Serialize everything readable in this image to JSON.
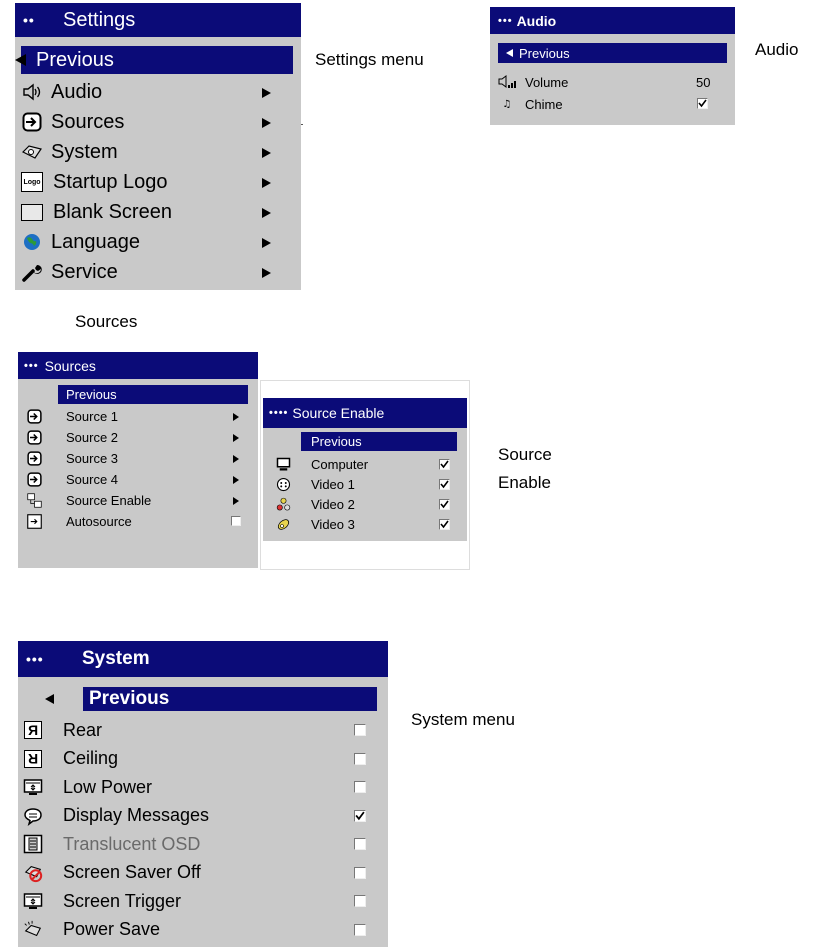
{
  "settings": {
    "header": "Settings",
    "previous": "Previous",
    "items": [
      {
        "icon": "speaker-icon",
        "label": "Audio"
      },
      {
        "icon": "source-input-icon",
        "label": "Sources"
      },
      {
        "icon": "system-icon",
        "label": "System"
      },
      {
        "icon": "logo-icon",
        "label": "Startup Logo",
        "icon_text": "Logo"
      },
      {
        "icon": "blank-screen-icon",
        "label": "Blank Screen"
      },
      {
        "icon": "globe-icon",
        "label": "Language"
      },
      {
        "icon": "wrench-icon",
        "label": "Service"
      }
    ]
  },
  "audio": {
    "header": "Audio",
    "previous": "Previous",
    "items": [
      {
        "icon": "volume-icon",
        "label": "Volume",
        "value": "50"
      },
      {
        "icon": "chime-icon",
        "label": "Chime",
        "checked": true
      }
    ]
  },
  "sources": {
    "header": "Sources",
    "previous": "Previous",
    "items": [
      {
        "icon": "source-input-icon",
        "label": "Source 1",
        "type": "submenu"
      },
      {
        "icon": "source-input-icon",
        "label": "Source 2",
        "type": "submenu"
      },
      {
        "icon": "source-input-icon",
        "label": "Source 3",
        "type": "submenu"
      },
      {
        "icon": "source-input-icon",
        "label": "Source 4",
        "type": "submenu"
      },
      {
        "icon": "source-enable-icon",
        "label": "Source Enable",
        "type": "submenu"
      },
      {
        "icon": "autosource-icon",
        "label": "Autosource",
        "type": "checkbox",
        "checked": false
      }
    ]
  },
  "source_enable": {
    "header": "Source Enable",
    "previous": "Previous",
    "items": [
      {
        "icon": "computer-icon",
        "label": "Computer",
        "checked": true
      },
      {
        "icon": "svideo-icon",
        "label": "Video 1",
        "checked": true
      },
      {
        "icon": "composite-icon",
        "label": "Video 2",
        "checked": true
      },
      {
        "icon": "component-icon",
        "label": "Video 3",
        "checked": true
      }
    ]
  },
  "system": {
    "header": "System",
    "previous": "Previous",
    "items": [
      {
        "icon": "rear-icon",
        "label": "Rear",
        "checked": false,
        "icon_text": "R"
      },
      {
        "icon": "ceiling-icon",
        "label": "Ceiling",
        "checked": false,
        "icon_text": "R"
      },
      {
        "icon": "low-power-icon",
        "label": "Low Power",
        "checked": false
      },
      {
        "icon": "display-messages-icon",
        "label": "Display Messages",
        "checked": true
      },
      {
        "icon": "translucent-osd-icon",
        "label": "Translucent OSD",
        "checked": false,
        "disabled": true
      },
      {
        "icon": "screen-saver-off-icon",
        "label": "Screen Saver Off",
        "checked": false
      },
      {
        "icon": "screen-trigger-icon",
        "label": "Screen Trigger",
        "checked": false
      },
      {
        "icon": "power-save-icon",
        "label": "Power Save",
        "checked": false
      }
    ]
  },
  "captions": {
    "settings": "Settings menu",
    "audio": "Audio",
    "sources": "Sources",
    "source_enable_1": "Source",
    "source_enable_2": "Enable",
    "system": "System menu"
  },
  "header_dots": {
    "two": "••",
    "three": "•••",
    "four": "••••"
  },
  "colors": {
    "header": "#0b0b78",
    "menu_bg": "#c9c9c9",
    "disabled_text": "#6a6a6a"
  }
}
